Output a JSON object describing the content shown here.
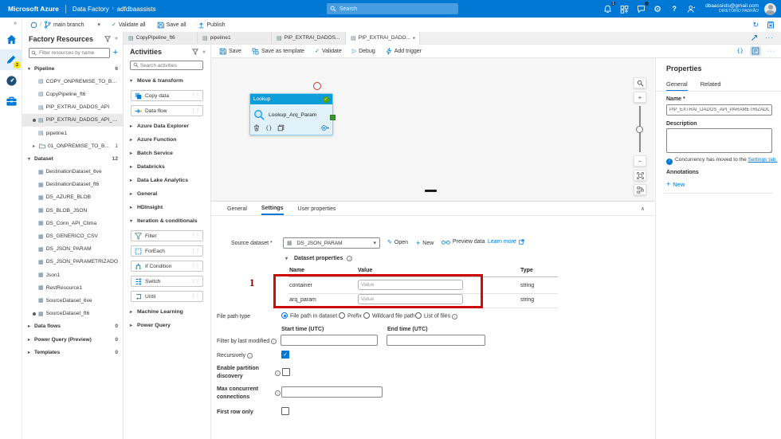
{
  "icons": {
    "breadcrumb_sep": "›",
    "collapse_left": "«",
    "collapse_double": "»",
    "expanded": "▾",
    "collapsed": "▸",
    "chevron_down": "▾",
    "chevron_up": "∧",
    "check": "✓",
    "play": "▷",
    "plus": "+",
    "minus": "−",
    "more": "···",
    "question": "?",
    "gear": "⚙",
    "pencil": "✎",
    "braces": "{}",
    "dot": "●",
    "grip": "⋮⋮",
    "refresh": "↻",
    "pipeline": "▤",
    "dataset": "▦",
    "folder": "▸",
    "slash": "/",
    "info": "i"
  },
  "colors": {
    "azure_blue": "#0078d4",
    "node_header": "#0d9dd9",
    "node_body": "#e1f1fa",
    "success_green": "#57a300",
    "port_green": "#3f9335",
    "highlight_red": "#cf0a0a"
  },
  "topbar": {
    "brand": "Microsoft Azure",
    "app": "Data Factory",
    "instance": "adfdbaassists",
    "search_placeholder": "Search",
    "bell_badge": "1",
    "email": "dbaassists@gmail.com",
    "directory": "DIRETÓRIO PADRÃO"
  },
  "cmdbar": {
    "branch": "main branch",
    "validate_all": "Validate all",
    "save_all": "Save all",
    "publish": "Publish"
  },
  "rail": {
    "author_badge": "2"
  },
  "factory": {
    "title": "Factory Resources",
    "filter_placeholder": "Filter resources by name",
    "tree": [
      {
        "label": "Pipeline",
        "count": "6"
      },
      {
        "label": "COPY_ONPREMISE_TO_BLOB"
      },
      {
        "label": "CopyPipeline_ft6"
      },
      {
        "label": "PIP_EXTRAI_DADOS_API"
      },
      {
        "label": "PIP_EXTRAI_DADOS_API_PAR..."
      },
      {
        "label": "pipeline1"
      },
      {
        "label": "01_ONPREMISE_TO_B...",
        "count": "1"
      },
      {
        "label": "Dataset",
        "count": "12"
      },
      {
        "label": "DestinationDataset_6ve"
      },
      {
        "label": "DestinationDataset_ft6"
      },
      {
        "label": "DS_AZURE_BLOB"
      },
      {
        "label": "DS_BLOB_JSON"
      },
      {
        "label": "DS_Conn_API_Clima"
      },
      {
        "label": "DS_GENERICO_CSV"
      },
      {
        "label": "DS_JSON_PARAM"
      },
      {
        "label": "DS_JSON_PARAMETRIZADO"
      },
      {
        "label": "Json1"
      },
      {
        "label": "RestResource1"
      },
      {
        "label": "SourceDataset_6ve"
      },
      {
        "label": "SourceDataset_ft6"
      },
      {
        "label": "Data flows",
        "count": "0"
      },
      {
        "label": "Power Query (Preview)",
        "count": "0"
      },
      {
        "label": "Templates",
        "count": "0"
      }
    ]
  },
  "activities": {
    "title": "Activities",
    "search_placeholder": "Search activities",
    "groups": [
      {
        "label": "Move & transform"
      },
      {
        "label": "Azure Data Explorer"
      },
      {
        "label": "Azure Function"
      },
      {
        "label": "Batch Service"
      },
      {
        "label": "Databricks"
      },
      {
        "label": "Data Lake Analytics"
      },
      {
        "label": "General"
      },
      {
        "label": "HDInsight"
      },
      {
        "label": "Iteration & conditionals"
      },
      {
        "label": "Machine Learning"
      },
      {
        "label": "Power Query"
      }
    ],
    "chips": [
      {
        "label": "Copy data"
      },
      {
        "label": "Data flow"
      },
      {
        "label": "Filter"
      },
      {
        "label": "ForEach"
      },
      {
        "label": "If Condition"
      },
      {
        "label": "Switch"
      },
      {
        "label": "Until"
      }
    ]
  },
  "tabs": {
    "items": [
      {
        "label": "CopyPipeline_ft6"
      },
      {
        "label": "pipeline1"
      },
      {
        "label": "PIP_EXTRAI_DADOS..."
      },
      {
        "label": "PIP_EXTRAI_DADO..."
      }
    ]
  },
  "toolbar": {
    "save": "Save",
    "save_as_template": "Save as template",
    "validate": "Validate",
    "debug": "Debug",
    "add_trigger": "Add trigger"
  },
  "canvas": {
    "node_type": "Lookup",
    "node_name": "Lookup_Arq_Param"
  },
  "config": {
    "tabs": [
      {
        "label": "General"
      },
      {
        "label": "Settings"
      },
      {
        "label": "User properties"
      }
    ],
    "source_dataset_label": "Source dataset *",
    "source_dataset_value": "DS_JSON_PARAM",
    "open": "Open",
    "new": "New",
    "preview": "Preview data",
    "learn_more": "Learn more",
    "dataset_properties_title": "Dataset properties",
    "columns": {
      "name": "Name",
      "value": "Value",
      "type": "Type"
    },
    "params": [
      {
        "name": "container",
        "placeholder": "Value",
        "type": "string"
      },
      {
        "name": "arq_param",
        "placeholder": "Value",
        "type": "string"
      }
    ],
    "marker": "1",
    "file_path_type_label": "File path type",
    "file_path_options": [
      {
        "label": "File path in dataset"
      },
      {
        "label": "Prefix"
      },
      {
        "label": "Wildcard file path"
      },
      {
        "label": "List of files"
      }
    ],
    "start_label": "Start time (UTC)",
    "end_label": "End time (UTC)",
    "filter_label": "Filter by last modified",
    "recursively_label": "Recursively",
    "partition_label_1": "Enable partition",
    "partition_label_2": "discovery",
    "max_conn_label_1": "Max concurrent",
    "max_conn_label_2": "connections",
    "first_row_label": "First row only"
  },
  "props": {
    "title": "Properties",
    "tab_general": "General",
    "tab_related": "Related",
    "name_label": "Name *",
    "name_value": "PIP_EXTRAI_DADOS_API_PARAMETRIZADO",
    "description_label": "Description",
    "concurrency_text": "Concurrency has moved to the",
    "concurrency_link": "Settings tab.",
    "annotations_label": "Annotations",
    "new_label": "New"
  }
}
